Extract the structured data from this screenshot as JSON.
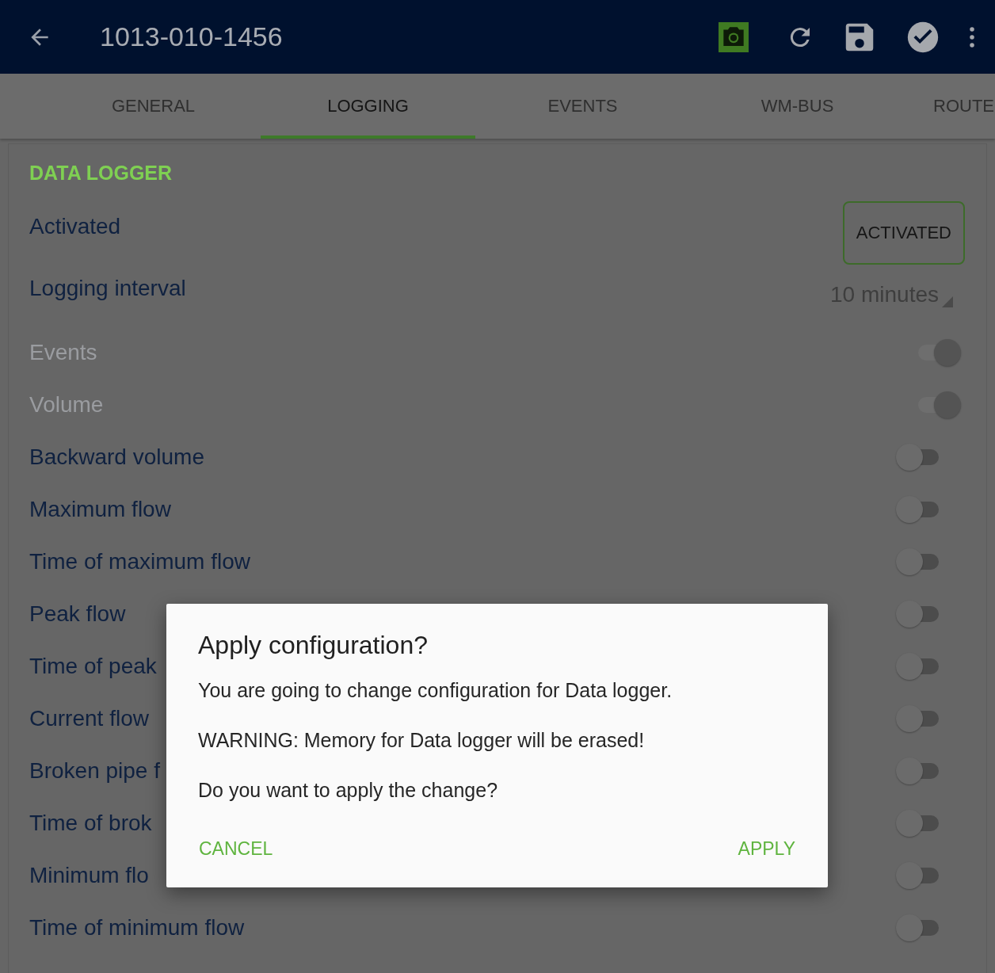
{
  "app_bar": {
    "title": "1013-010-1456",
    "camera_highlighted": true
  },
  "tabs": [
    {
      "label": "GENERAL",
      "selected": false
    },
    {
      "label": "LOGGING",
      "selected": true
    },
    {
      "label": "EVENTS",
      "selected": false
    },
    {
      "label": "WM-BUS",
      "selected": false
    },
    {
      "label": "ROUTE",
      "selected": false
    }
  ],
  "section": {
    "title": "DATA LOGGER"
  },
  "rows": [
    {
      "kind": "button",
      "label": "Activated",
      "value": "ACTIVATED"
    },
    {
      "kind": "dropdown",
      "label": "Logging interval",
      "value": "10 minutes"
    },
    {
      "kind": "toggle",
      "label": "Events",
      "on": true,
      "disabled": true
    },
    {
      "kind": "toggle",
      "label": "Volume",
      "on": true,
      "disabled": true
    },
    {
      "kind": "toggle",
      "label": "Backward volume",
      "on": false,
      "disabled": false
    },
    {
      "kind": "toggle",
      "label": "Maximum flow",
      "on": false,
      "disabled": false
    },
    {
      "kind": "toggle",
      "label": "Time of maximum flow",
      "on": false,
      "disabled": false
    },
    {
      "kind": "toggle",
      "label": "Peak flow",
      "on": false,
      "disabled": false
    },
    {
      "kind": "toggle",
      "label": "Time of peak",
      "on": false,
      "disabled": false
    },
    {
      "kind": "toggle",
      "label": "Current flow",
      "on": false,
      "disabled": false
    },
    {
      "kind": "toggle",
      "label": "Broken pipe f",
      "on": false,
      "disabled": false
    },
    {
      "kind": "toggle",
      "label": "Time of brok",
      "on": false,
      "disabled": false
    },
    {
      "kind": "toggle",
      "label": "Minimum flo",
      "on": false,
      "disabled": false
    },
    {
      "kind": "toggle",
      "label": "Time of minimum flow",
      "on": false,
      "disabled": false
    }
  ],
  "dialog": {
    "title": "Apply configuration?",
    "messages": [
      "You are going to change configuration for Data logger.",
      "WARNING: Memory for Data logger will be erased!",
      "Do you want to apply the change?"
    ],
    "buttons": [
      "CANCEL",
      "APPLY"
    ]
  }
}
